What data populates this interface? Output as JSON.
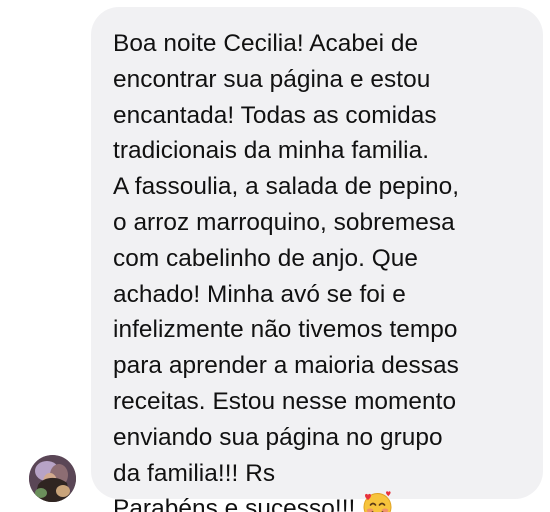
{
  "message": {
    "text": "Boa noite Cecilia! Acabei de\nencontrar sua página e estou\nencantada! Todas as comidas\ntradicionais da minha familia.\nA fassoulia, a salada de pepino,\no arroz marroquino, sobremesa\ncom cabelinho de anjo. Que\nachado! Minha avó se foi e\ninfelizmente não tivemos tempo\npara aprender a maioria dessas\nreceitas. Estou nesse momento\nenviando sua página no grupo\nda familia!!! Rs\nParabéns e sucesso!!!",
    "trailing_emoji": "smiling-face-with-hearts-icon"
  },
  "colors": {
    "bubble_background": "#f1f1f3",
    "text": "#111111",
    "page_background": "#ffffff"
  }
}
